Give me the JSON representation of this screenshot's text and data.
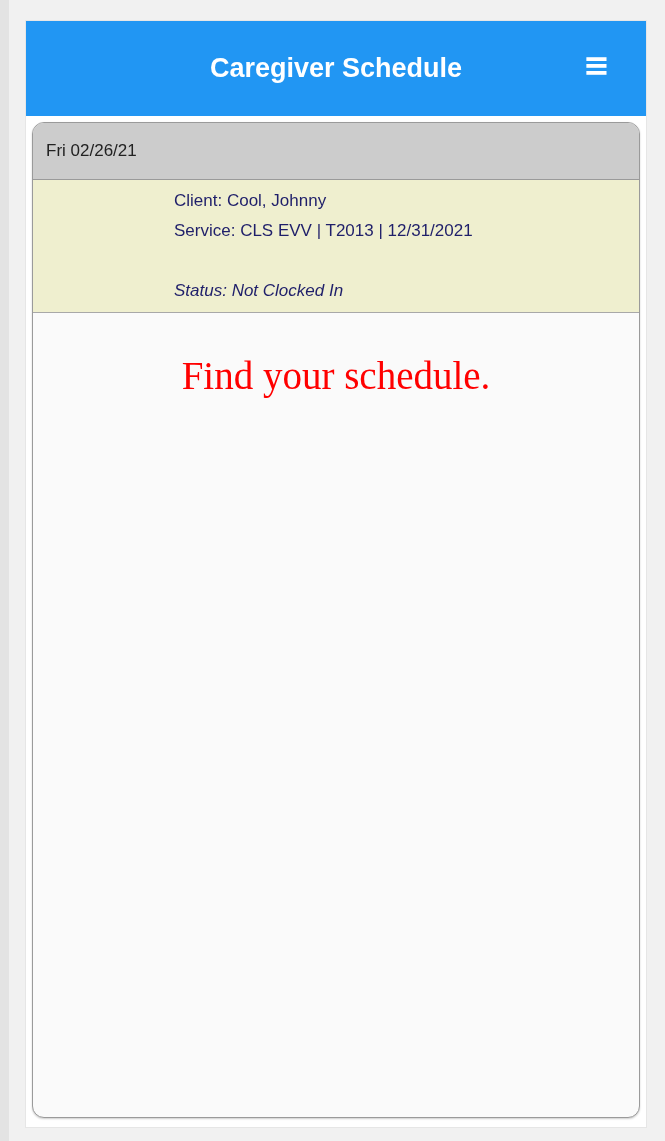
{
  "header": {
    "title": "Caregiver Schedule",
    "menu_icon": "≡"
  },
  "schedule": {
    "date": "Fri 02/26/21",
    "visits": [
      {
        "client": "Client: Cool, Johnny",
        "service": "Service: CLS EVV | T2013 | 12/31/2021",
        "status": "Status: Not Clocked In"
      }
    ]
  },
  "annotation": "Find your schedule."
}
